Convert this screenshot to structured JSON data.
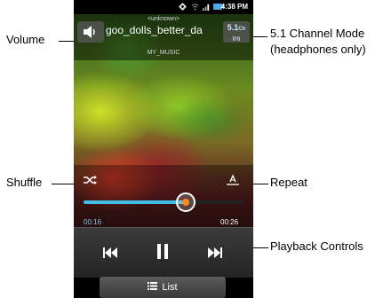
{
  "status_bar": {
    "time": "4:38 PM"
  },
  "player": {
    "album_label": "<unknown>",
    "track_title": "goo_dolls_better_da",
    "artist_label": "MY_MUSIC",
    "channel_button_label": "5.1",
    "channel_button_sub": "Ch",
    "progress": 0.64,
    "elapsed": "00:16",
    "duration": "00:26",
    "list_button_label": "List"
  },
  "callouts": {
    "volume": "Volume",
    "channel_mode_line1": "5.1 Channel Mode",
    "channel_mode_line2": "(headphones only)",
    "shuffle": "Shuffle",
    "repeat": "Repeat",
    "playback": "Playback Controls"
  },
  "colors": {
    "progress": "#41bde8",
    "knob_center": "#ff8a1a",
    "elapsed": "#79c8e6",
    "duration": "#ffffff"
  }
}
